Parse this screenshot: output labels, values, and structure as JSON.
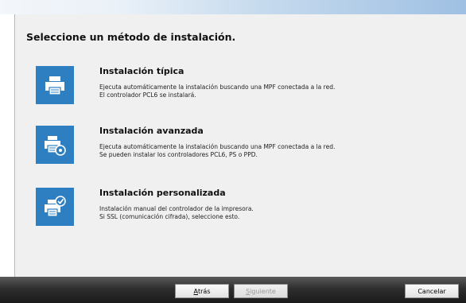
{
  "dialog": {
    "heading": "Seleccione un método de instalación."
  },
  "options": [
    {
      "title": "Instalación típica",
      "desc_line1": "Ejecuta automáticamente la instalación buscando una MPF conectada a la red.",
      "desc_line2": "El controlador PCL6 se instalará.",
      "icon": "printer-icon"
    },
    {
      "title": "Instalación avanzada",
      "desc_line1": "Ejecuta automáticamente la instalación buscando una MPF conectada a la red.",
      "desc_line2": "Se pueden instalar los controladores PCL6, PS o PPD.",
      "icon": "printer-gear-icon"
    },
    {
      "title": "Instalación personalizada",
      "desc_line1": "Instalación manual del controlador de la impresora.",
      "desc_line2": "Si SSL (comunicación cifrada), seleccione esto.",
      "icon": "printer-check-icon"
    }
  ],
  "footer": {
    "back_label_access": "A",
    "back_label_rest": "trás",
    "next_label_access": "S",
    "next_label_rest": "iguiente",
    "cancel_label": "Cancelar"
  },
  "colors": {
    "tile_blue": "#2e7fc2",
    "panel_bg": "#f0f0f0",
    "footer_dark": "#2e2e2e"
  }
}
